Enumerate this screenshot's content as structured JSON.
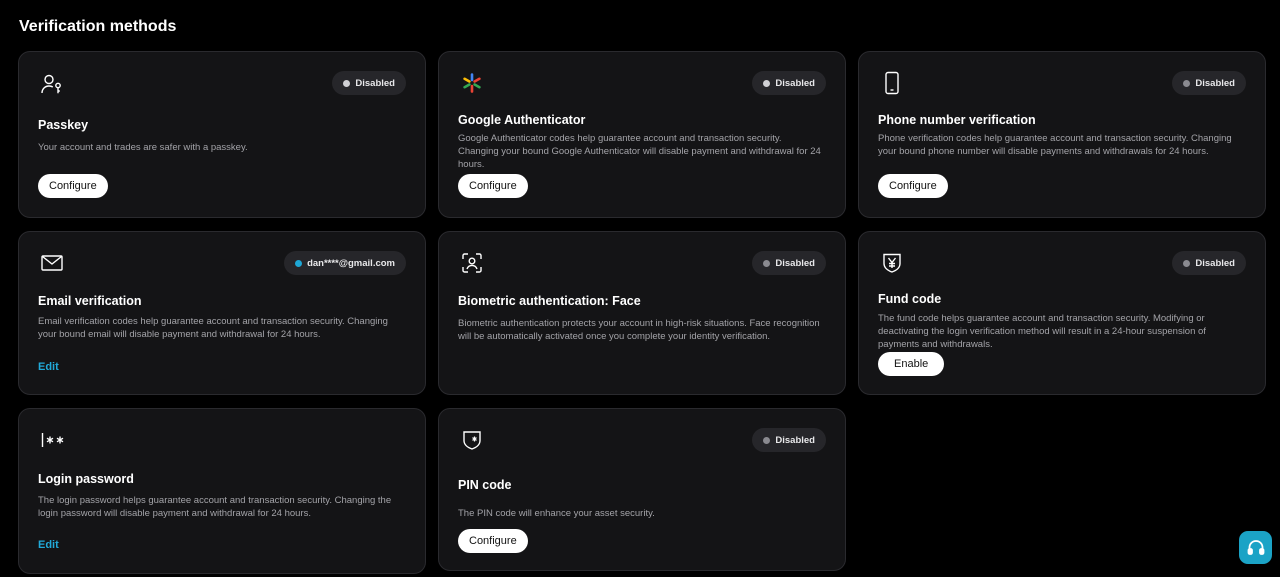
{
  "section_title": "Verification methods",
  "cards": {
    "passkey": {
      "icon": "user-key-icon",
      "status": "Disabled",
      "title": "Passkey",
      "description": "Your account and trades are safer with a passkey.",
      "action": "Configure"
    },
    "google_auth": {
      "icon": "google-authenticator-icon",
      "status": "Disabled",
      "title": "Google Authenticator",
      "description": "Google Authenticator codes help guarantee account and transaction security. Changing your bound Google Authenticator will disable payment and withdrawal for 24 hours.",
      "action": "Configure"
    },
    "phone": {
      "icon": "phone-icon",
      "status": "Disabled",
      "title": "Phone number verification",
      "description": "Phone verification codes help guarantee account and transaction security. Changing your bound phone number will disable payments and withdrawals for 24 hours.",
      "action": "Configure"
    },
    "email": {
      "icon": "mail-icon",
      "status": "dan****@gmail.com",
      "title": "Email verification",
      "description": "Email verification codes help guarantee account and transaction security. Changing your bound email will disable payment and withdrawal for 24 hours.",
      "action": "Edit"
    },
    "biometric": {
      "icon": "face-scan-icon",
      "status": "Disabled",
      "title": "Biometric authentication: Face",
      "description": "Biometric authentication protects your account in high-risk situations. Face recognition will be automatically activated once you complete your identity verification."
    },
    "fund_code": {
      "icon": "yen-shield-icon",
      "status": "Disabled",
      "title": "Fund code",
      "description": "The fund code helps guarantee account and transaction security. Modifying or deactivating the login verification method will result in a 24-hour suspension of payments and withdrawals.",
      "action": "Enable"
    },
    "login_password": {
      "icon": "password-icon",
      "title": "Login password",
      "description": "The login password helps guarantee account and transaction security. Changing the login password will disable payment and withdrawal for 24 hours.",
      "action": "Edit"
    },
    "pin": {
      "icon": "shield-star-icon",
      "status": "Disabled",
      "title": "PIN code",
      "description": "The PIN code will enhance your asset security.",
      "action": "Configure"
    }
  },
  "support": {
    "icon": "headset-icon"
  },
  "colors": {
    "background": "#000000",
    "card": "#141416",
    "accent": "#21a9d8",
    "support_button": "#1ba3c6"
  }
}
